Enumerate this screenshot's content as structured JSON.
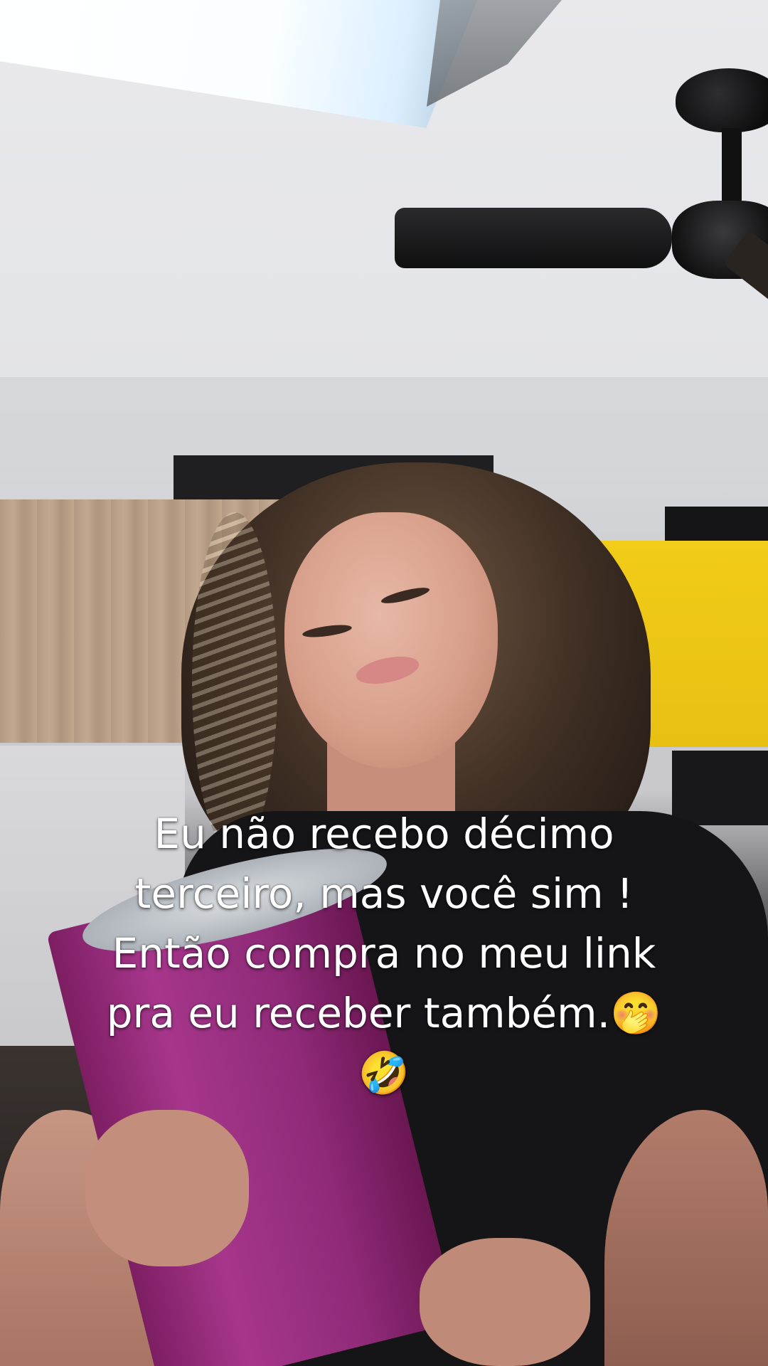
{
  "caption": {
    "lines": [
      "Eu não recebo décimo",
      "terceiro, mas você sim !",
      "Então compra no meu link",
      "pra eu receber também.🤭",
      "🤣"
    ]
  }
}
